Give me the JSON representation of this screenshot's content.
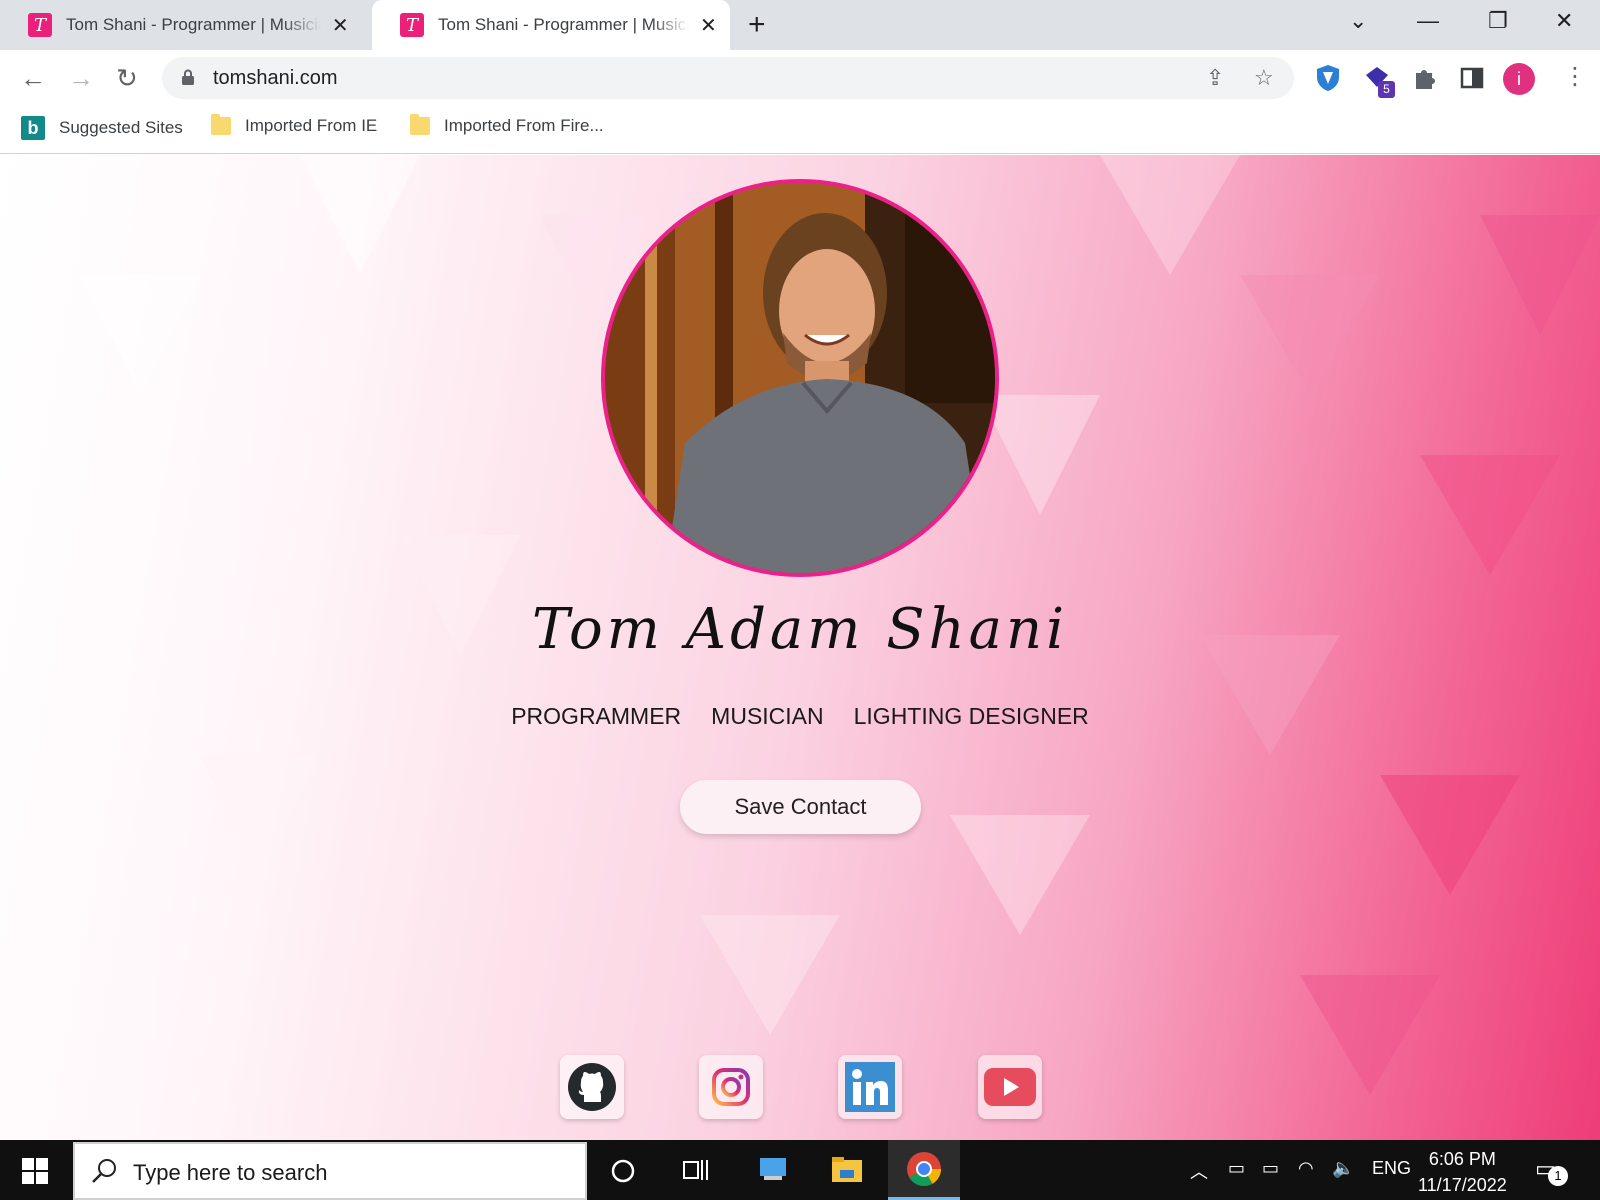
{
  "browser": {
    "tabs": [
      {
        "title": "Tom Shani - Programmer | Musician | Lighting Designer",
        "favicon_letter": "T"
      },
      {
        "title": "Tom Shani - Programmer | Musician | Lighting Designer",
        "favicon_letter": "T"
      }
    ],
    "url": "tomshani.com",
    "extension_badge": "5",
    "profile_initial": "i",
    "bookmarks": [
      {
        "label": "Suggested Sites",
        "icon": "bing-icon"
      },
      {
        "label": "Imported From IE",
        "icon": "folder-icon"
      },
      {
        "label": "Imported From Fire...",
        "icon": "folder-icon"
      }
    ]
  },
  "page": {
    "name": "Tom Adam Shani",
    "roles": [
      "Programmer",
      "Musician",
      "Lighting Designer"
    ],
    "save_contact_label": "Save Contact",
    "social_icons": [
      "github-icon",
      "instagram-icon",
      "linkedin-icon",
      "youtube-icon"
    ],
    "accent_color": "#ec1f8b"
  },
  "taskbar": {
    "search_placeholder": "Type here to search",
    "language": "ENG",
    "time": "6:06 PM",
    "date": "11/17/2022",
    "notification_count": "1"
  }
}
